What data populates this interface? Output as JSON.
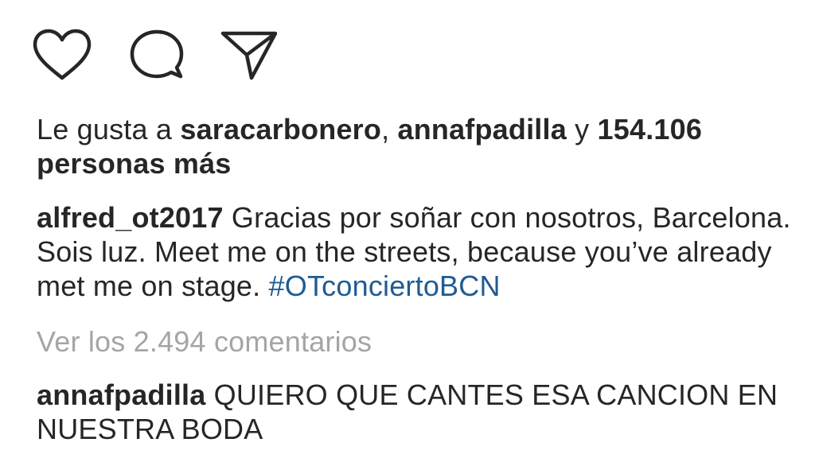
{
  "actions": {
    "like_icon": "heart-outline",
    "comment_icon": "speech-bubble-outline",
    "share_icon": "paper-plane-outline"
  },
  "likes": {
    "prefix": "Le gusta a ",
    "user1": "saracarbonero",
    "separator": ", ",
    "user2": "annafpadilla",
    "conjunction": " y ",
    "count": "154.106",
    "line_break_suffix": "personas más"
  },
  "caption": {
    "username": "alfred_ot2017",
    "text": " Gracias por soñar con nosotros, Barcelona. Sois luz. Meet me on the streets, because you’ve already met me on stage. ",
    "hashtag": "#OTconciertoBCN"
  },
  "view_comments": {
    "label": "Ver los 2.494 comentarios"
  },
  "comment": {
    "username": "annafpadilla",
    "text": " QUIERO QUE CANTES ESA CANCION EN NUESTRA BODA"
  },
  "colors": {
    "text": "#262626",
    "muted": "#a5a5a5",
    "hashtag": "#1f5b92"
  }
}
